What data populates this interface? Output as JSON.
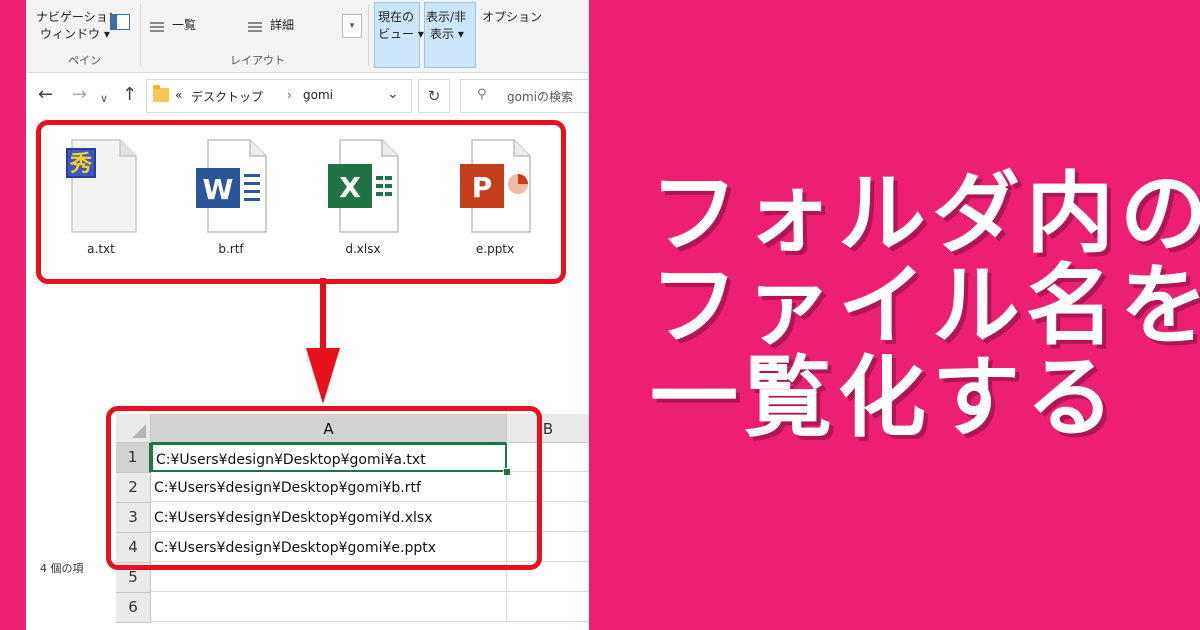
{
  "ribbon": {
    "nav_pane_line1": "ナビゲーション",
    "nav_pane_line2": "ウィンドウ ▾",
    "list_label": "一覧",
    "details_label": "詳細",
    "current_view_line1": "現在の",
    "current_view_line2": "ビュー ▾",
    "show_hide_line1": "表示/非",
    "show_hide_line2": "表示 ▾",
    "options_label": "オプション",
    "group_pane": "ペイン",
    "group_layout": "レイアウト"
  },
  "address": {
    "chevrons": "«",
    "crumb_desktop": "デスクトップ",
    "crumb_sep": "›",
    "crumb_folder": "gomi",
    "search_placeholder": "gomiの検索"
  },
  "files": [
    {
      "name": "a.txt",
      "icon": "text-file-icon"
    },
    {
      "name": "b.rtf",
      "icon": "word-file-icon"
    },
    {
      "name": "d.xlsx",
      "icon": "excel-file-icon"
    },
    {
      "name": "e.pptx",
      "icon": "powerpoint-file-icon"
    }
  ],
  "status": {
    "item_count": "4 個の項"
  },
  "sheet": {
    "columns": [
      "A",
      "B"
    ],
    "rows": [
      {
        "num": "1",
        "value": "C:¥Users¥design¥Desktop¥gomi¥a.txt"
      },
      {
        "num": "2",
        "value": "C:¥Users¥design¥Desktop¥gomi¥b.rtf"
      },
      {
        "num": "3",
        "value": "C:¥Users¥design¥Desktop¥gomi¥d.xlsx"
      },
      {
        "num": "4",
        "value": "C:¥Users¥design¥Desktop¥gomi¥e.pptx"
      },
      {
        "num": "5",
        "value": ""
      },
      {
        "num": "6",
        "value": ""
      }
    ]
  },
  "headline": {
    "line1": "フォルダ内の",
    "line2": "ファイル名を",
    "line3": "一覧化する"
  },
  "colors": {
    "background": "#EC1F72",
    "highlight_frame": "#E8101C",
    "excel_green": "#217346"
  }
}
